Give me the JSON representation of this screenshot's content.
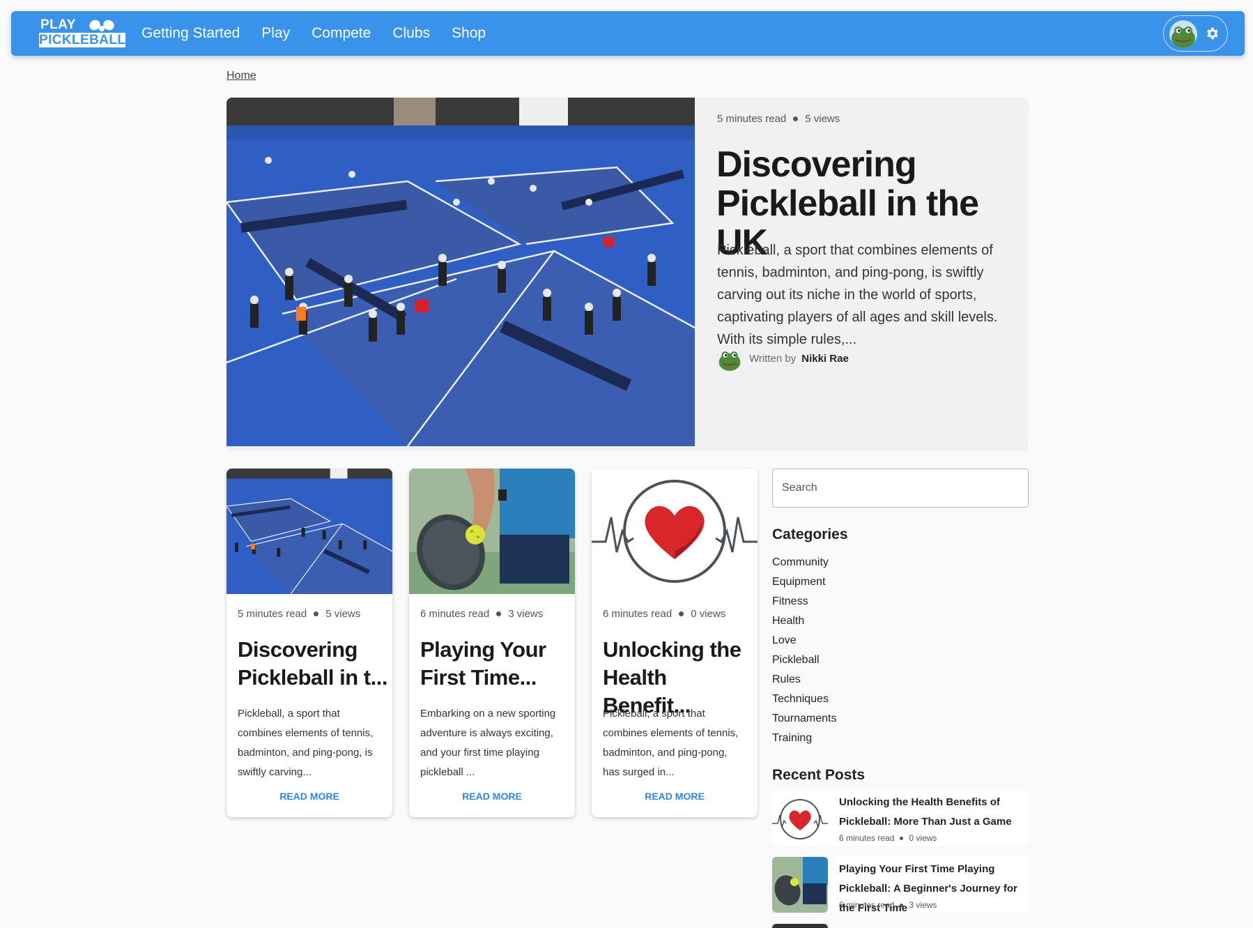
{
  "nav": {
    "logo_top": "PLAY",
    "logo_bottom": "PICKLEBALL",
    "links": [
      "Getting Started",
      "Play",
      "Compete",
      "Clubs",
      "Shop"
    ]
  },
  "breadcrumb": "Home",
  "hero": {
    "read_time": "5 minutes read",
    "views": "5 views",
    "title": "Discovering Pickleball in the UK",
    "excerpt": "Pickleball, a sport that combines elements of tennis, badminton, and ping-pong, is swiftly carving out its niche in the world of sports, captivating players of all ages and skill levels. With its simple rules,...",
    "written_by": "Written by",
    "author": "Nikki Rae"
  },
  "cards": [
    {
      "read_time": "5 minutes read",
      "views": "5 views",
      "title": "Discovering Pickleball in t...",
      "excerpt": "Pickleball, a sport that combines elements of tennis, badminton, and ping-pong, is swiftly carving...",
      "button": "READ MORE"
    },
    {
      "read_time": "6 minutes read",
      "views": "3 views",
      "title": "Playing Your First Time...",
      "excerpt": "Embarking on a new sporting adventure is always exciting, and your first time playing pickleball ...",
      "button": "READ MORE"
    },
    {
      "read_time": "6 minutes read",
      "views": "0 views",
      "title": "Unlocking the Health Benefit...",
      "excerpt": "Pickleball, a sport that combines elements of tennis, badminton, and ping-pong, has surged in...",
      "button": "READ MORE"
    }
  ],
  "sidebar": {
    "search_placeholder": "Search",
    "categories_heading": "Categories",
    "categories": [
      "Community",
      "Equipment",
      "Fitness",
      "Health",
      "Love",
      "Pickleball",
      "Rules",
      "Techniques",
      "Tournaments",
      "Training"
    ],
    "recent_heading": "Recent Posts",
    "recent_posts": [
      {
        "title": "Unlocking the Health Benefits of Pickleball: More Than Just a Game",
        "read_time": "6 minutes read",
        "views": "0 views"
      },
      {
        "title": "Playing Your First Time Playing Pickleball: A Beginner's Journey for the First Time",
        "read_time": "6 minutes read",
        "views": "3 views"
      }
    ]
  },
  "icons": [
    "paddles-icon",
    "avatar-frog",
    "gear-icon",
    "heart-icon"
  ],
  "colors": {
    "brand": "#3a93ea",
    "link": "#2f86df"
  }
}
